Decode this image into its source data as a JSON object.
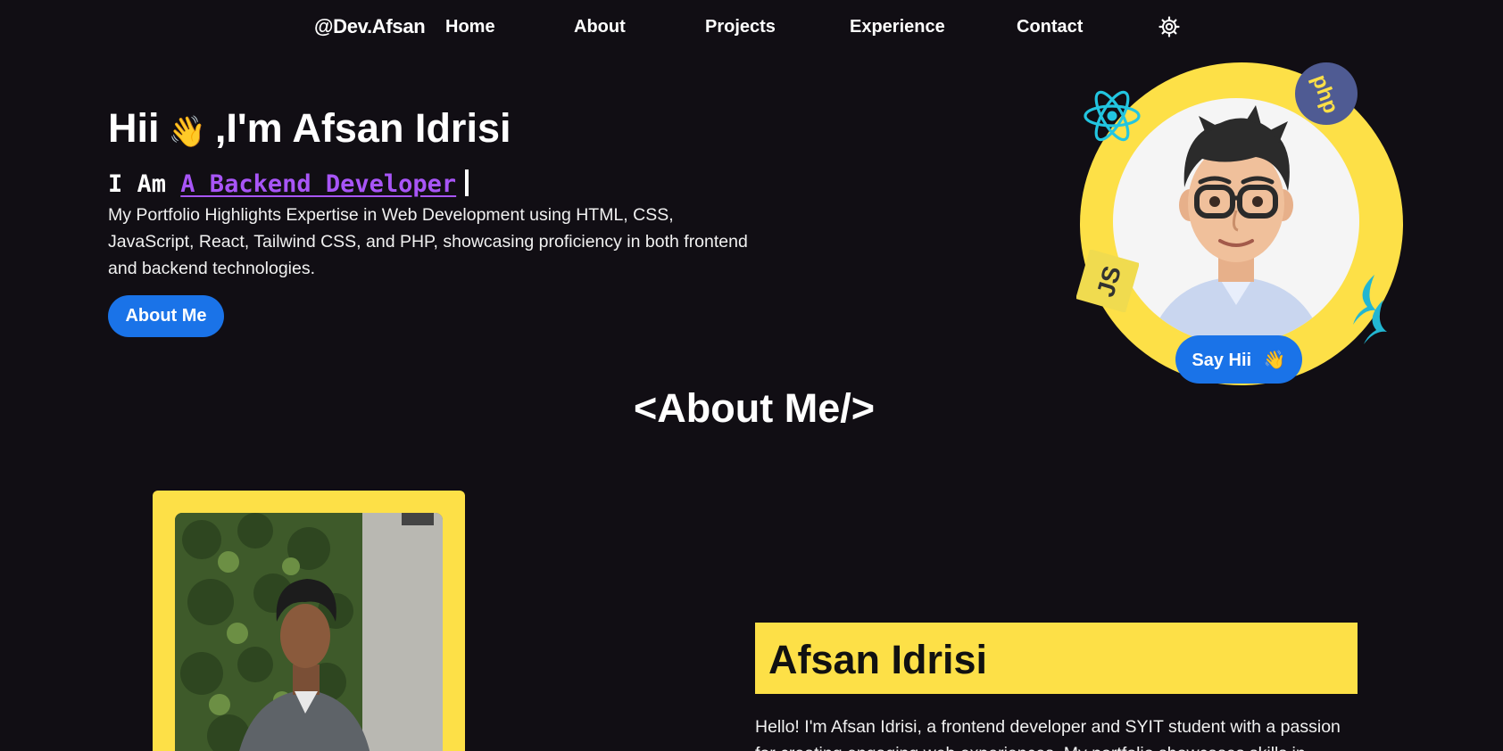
{
  "nav": {
    "brand": "@Dev.Afsan",
    "links": [
      "Home",
      "About",
      "Projects",
      "Experience",
      "Contact"
    ],
    "theme_icon": "gear-icon"
  },
  "hero": {
    "greeting": "Hii",
    "wave_emoji": "👋",
    "name": ",I'm Afsan Idrisi",
    "role_prefix": "I Am",
    "role": "A Backend Developer",
    "description": "My Portfolio Highlights Expertise in Web Development using HTML, CSS, JavaScript, React, Tailwind CSS, and PHP, showcasing proficiency in both frontend and backend technologies.",
    "button": "About Me",
    "say_hii": "Say Hii",
    "say_hii_emoji": "👋",
    "badges": {
      "php": "php",
      "js": "JS"
    }
  },
  "about": {
    "heading": "<About Me/>",
    "name": "Afsan Idrisi",
    "text": "Hello! I'm Afsan Idrisi, a frontend developer and SYIT student with a passion for creating engaging web experiences. My portfolio showcases skills in"
  },
  "colors": {
    "background": "#110e14",
    "accent_yellow": "#fde047",
    "button_blue": "#1a73e8",
    "role_purple": "#a855f7"
  }
}
